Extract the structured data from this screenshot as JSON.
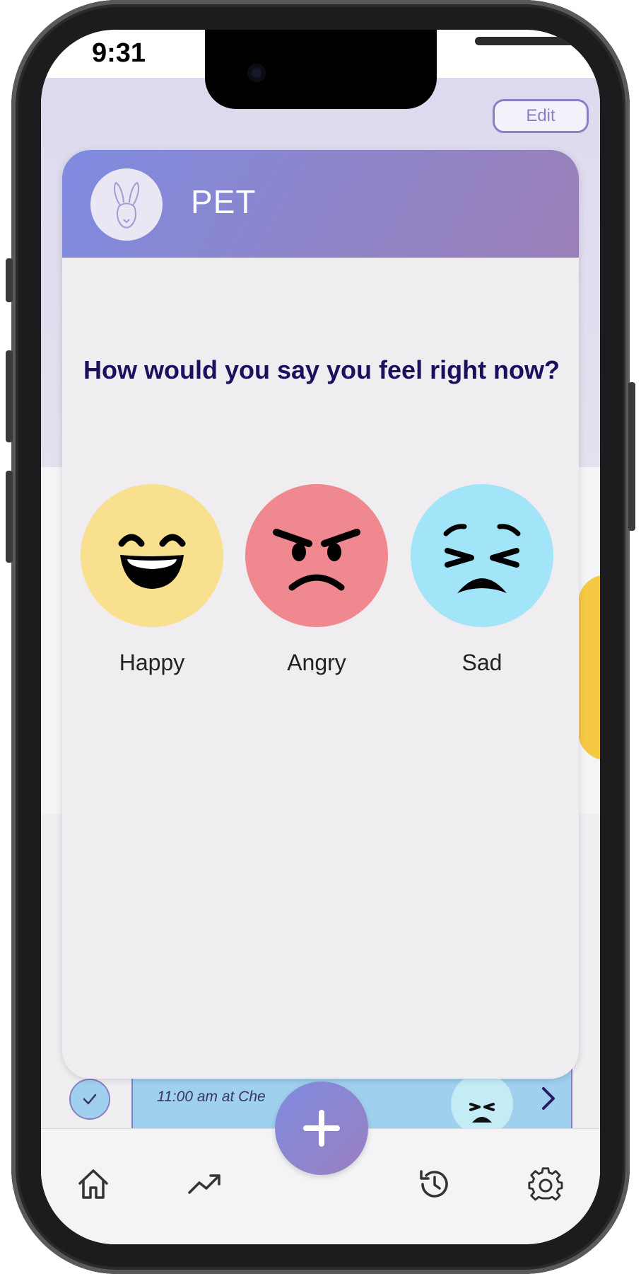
{
  "status_bar": {
    "time": "9:31"
  },
  "header": {
    "edit_label": "Edit"
  },
  "modal": {
    "title": "PET",
    "avatar_icon": "rabbit-icon",
    "question": "How would you say you feel right now?",
    "moods": [
      {
        "label": "Happy",
        "icon": "grinning-face-icon",
        "color": "#f9e08e"
      },
      {
        "label": "Angry",
        "icon": "angry-face-icon",
        "color": "#f08890"
      },
      {
        "label": "Sad",
        "icon": "persevering-face-icon",
        "color": "#a2e4f8"
      }
    ]
  },
  "background_entry": {
    "text": "11:00 am at Che"
  },
  "tab_bar": {
    "items": [
      "home-icon",
      "trending-icon",
      "add-icon",
      "history-icon",
      "settings-icon"
    ]
  },
  "colors": {
    "accent": "#8a7fc4",
    "header_gradient_start": "#7f8be0",
    "header_gradient_end": "#9a80b8",
    "question_text": "#1d0f5e"
  }
}
